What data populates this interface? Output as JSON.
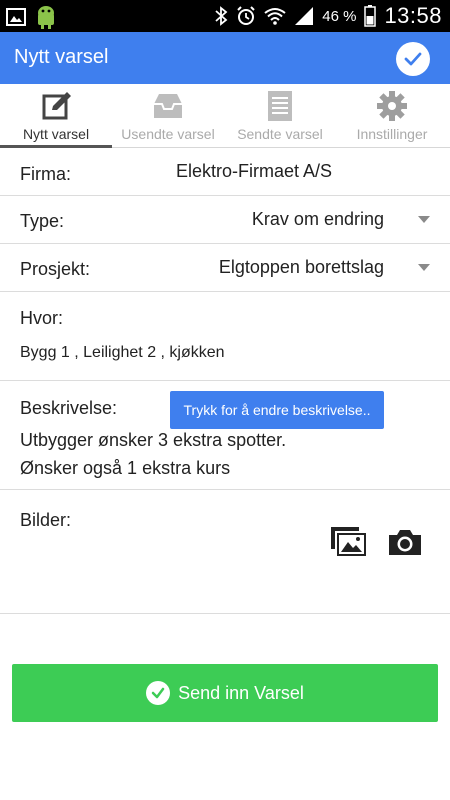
{
  "status_bar": {
    "battery_percent": "46 %",
    "time": "13:58",
    "icons": [
      "gallery-icon",
      "android-icon",
      "bluetooth-icon",
      "alarm-icon",
      "wifi-icon",
      "signal-icon",
      "battery-icon"
    ]
  },
  "app_bar": {
    "title": "Nytt varsel",
    "confirm_icon": "check-icon",
    "color": "#3f7fee"
  },
  "tabs": [
    {
      "label": "Nytt varsel",
      "icon": "edit-icon",
      "active": true
    },
    {
      "label": "Usendte varsel",
      "icon": "inbox-icon",
      "active": false
    },
    {
      "label": "Sendte varsel",
      "icon": "document-icon",
      "active": false
    },
    {
      "label": "Innstillinger",
      "icon": "gear-icon",
      "active": false
    }
  ],
  "form": {
    "firma": {
      "label": "Firma:",
      "value": "Elektro-Firmaet A/S"
    },
    "type": {
      "label": "Type:",
      "value": "Krav om endring"
    },
    "prosjekt": {
      "label": "Prosjekt:",
      "value": "Elgtoppen borettslag"
    },
    "hvor": {
      "label": "Hvor:",
      "value": "Bygg 1 , Leilighet 2 , kjøkken"
    },
    "beskrivelse": {
      "label": "Beskrivelse:",
      "button_label": "Trykk for å endre beskrivelse..",
      "lines": [
        "Utbygger ønsker 3 ekstra spotter.",
        "Ønsker også 1 ekstra kurs"
      ]
    },
    "bilder": {
      "label": "Bilder:",
      "icons": [
        "image-gallery-icon",
        "camera-icon"
      ]
    }
  },
  "send_button": {
    "label": "Send inn Varsel",
    "color": "#3dcc55"
  }
}
